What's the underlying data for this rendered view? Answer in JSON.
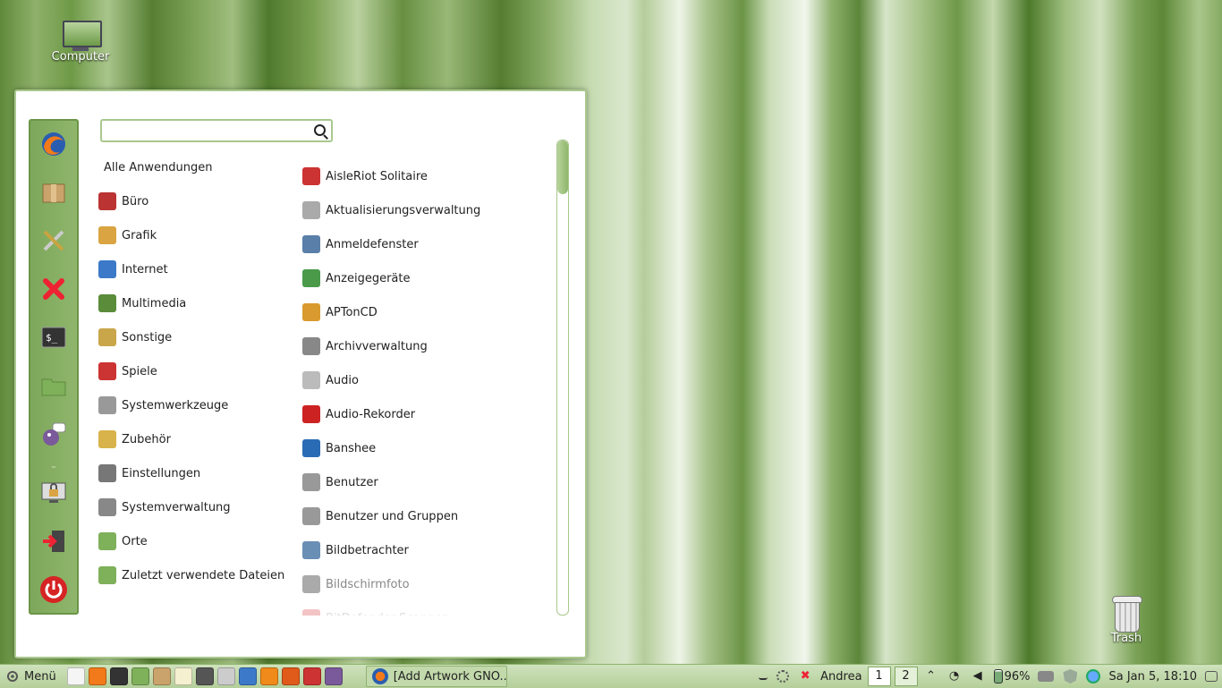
{
  "desktop": {
    "computer_label": "Computer",
    "trash_label": "Trash"
  },
  "menu": {
    "search": {
      "value": "",
      "placeholder": ""
    },
    "favorites": [
      "firefox-icon",
      "package-icon",
      "tools-icon",
      "close-icon",
      "terminal-icon",
      "folder-icon",
      "pidgin-icon",
      "lock-screen-icon",
      "logout-icon",
      "power-icon"
    ],
    "categories_header": "Alle Anwendungen",
    "categories": [
      {
        "label": "Büro",
        "icon": "office-icon",
        "color": "#b33"
      },
      {
        "label": "Grafik",
        "icon": "graphics-icon",
        "color": "#d9a441"
      },
      {
        "label": "Internet",
        "icon": "internet-icon",
        "color": "#3c7ac9"
      },
      {
        "label": "Multimedia",
        "icon": "multimedia-icon",
        "color": "#5a8c3a"
      },
      {
        "label": "Sonstige",
        "icon": "misc-icon",
        "color": "#c9a64a"
      },
      {
        "label": "Spiele",
        "icon": "games-icon",
        "color": "#c33"
      },
      {
        "label": "Systemwerkzeuge",
        "icon": "system-tools-icon",
        "color": "#999"
      },
      {
        "label": "Zubehör",
        "icon": "accessories-icon",
        "color": "#d8b24a"
      },
      {
        "label": "Einstellungen",
        "icon": "settings-icon",
        "color": "#777"
      },
      {
        "label": "Systemverwaltung",
        "icon": "administration-icon",
        "color": "#888"
      },
      {
        "label": "Orte",
        "icon": "places-folder-icon",
        "color": "#7fb05a"
      },
      {
        "label": "Zuletzt verwendete  Dateien",
        "icon": "recent-folder-icon",
        "color": "#7fb05a"
      }
    ],
    "apps": [
      {
        "label": "AisleRiot Solitaire",
        "icon": "solitaire-icon",
        "color": "#c33"
      },
      {
        "label": "Aktualisierungsverwaltung",
        "icon": "update-shield-icon",
        "color": "#aaa"
      },
      {
        "label": "Anmeldefenster",
        "icon": "login-window-icon",
        "color": "#5a7fa8"
      },
      {
        "label": "Anzeigegeräte",
        "icon": "display-icon",
        "color": "#4a9a4a"
      },
      {
        "label": "APTonCD",
        "icon": "aptoncd-icon",
        "color": "#d99b2f"
      },
      {
        "label": "Archivverwaltung",
        "icon": "archive-icon",
        "color": "#888"
      },
      {
        "label": "Audio",
        "icon": "audio-icon",
        "color": "#bbb"
      },
      {
        "label": "Audio-Rekorder",
        "icon": "microphone-icon",
        "color": "#c22"
      },
      {
        "label": "Banshee",
        "icon": "banshee-icon",
        "color": "#2a6bb5"
      },
      {
        "label": "Benutzer",
        "icon": "users-icon",
        "color": "#999"
      },
      {
        "label": "Benutzer und Gruppen",
        "icon": "users-groups-icon",
        "color": "#999"
      },
      {
        "label": "Bildbetrachter",
        "icon": "image-viewer-icon",
        "color": "#6a8fb5"
      },
      {
        "label": "Bildschirmfoto",
        "icon": "screenshot-icon",
        "color": "#aaa",
        "state": "dim"
      },
      {
        "label": "BitDefender Scanner",
        "icon": "bitdefender-icon",
        "color": "#f3c4c4",
        "state": "fade"
      }
    ]
  },
  "taskbar": {
    "menu_label": "Menü",
    "launchers": [
      "show-desktop-icon",
      "firefox-icon",
      "terminal-icon",
      "folder-icon",
      "package-icon",
      "text-editor-icon",
      "camera-icon",
      "tools-icon",
      "network-icon",
      "vlc-icon",
      "ubuntu-one-icon",
      "cards-icon",
      "pidgin-icon"
    ],
    "window_title": "[Add  Artwork GNO...",
    "user": "Andrea",
    "workspaces": [
      "1",
      "2"
    ],
    "battery": "96%",
    "clock": "Sa Jan  5, 18:10"
  }
}
